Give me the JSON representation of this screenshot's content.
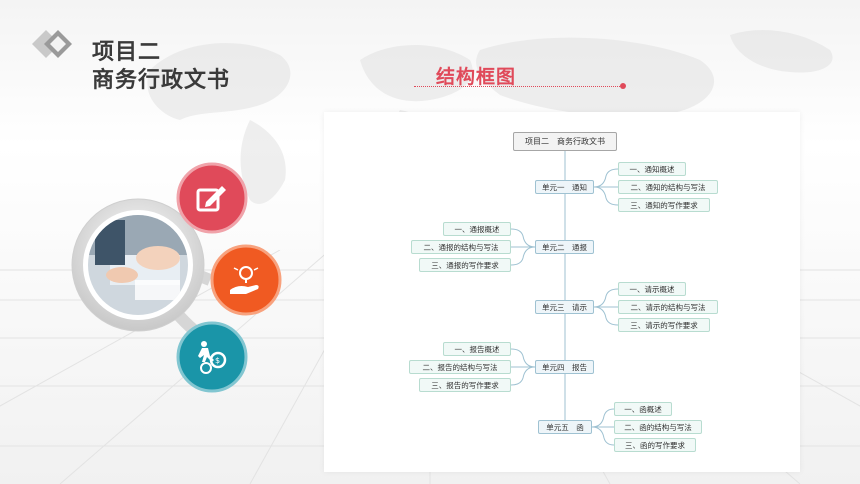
{
  "header": {
    "title_line1": "项目二",
    "title_line2": "商务行政文书"
  },
  "section_title": "结构框图",
  "diagram": {
    "root": "项目二　商务行政文书",
    "units": [
      {
        "label": "单元一　通知",
        "side": "right",
        "children": [
          "一、通知概述",
          "二、通知的结构与写法",
          "三、通知的写作要求"
        ]
      },
      {
        "label": "单元二　通报",
        "side": "left",
        "children": [
          "一、通报概述",
          "二、通报的结构与写法",
          "三、通报的写作要求"
        ]
      },
      {
        "label": "单元三　请示",
        "side": "right",
        "children": [
          "一、请示概述",
          "二、请示的结构与写法",
          "三、请示的写作要求"
        ]
      },
      {
        "label": "单元四　报告",
        "side": "left",
        "children": [
          "一、报告概述",
          "二、报告的结构与写法",
          "三、报告的写作要求"
        ]
      },
      {
        "label": "单元五　函",
        "side": "right",
        "children": [
          "一、函概述",
          "二、函的结构与写法",
          "三、函的写作要求"
        ]
      }
    ]
  },
  "icons": {
    "edit": "edit-icon",
    "idea": "lightbulb-hand-icon",
    "growth": "climbing-gears-icon",
    "photo": "business-photo"
  },
  "colors": {
    "accent_red": "#e04a5a",
    "accent_orange": "#f05a22",
    "accent_teal": "#1a95a8",
    "title_dark": "#3a3a3a"
  }
}
